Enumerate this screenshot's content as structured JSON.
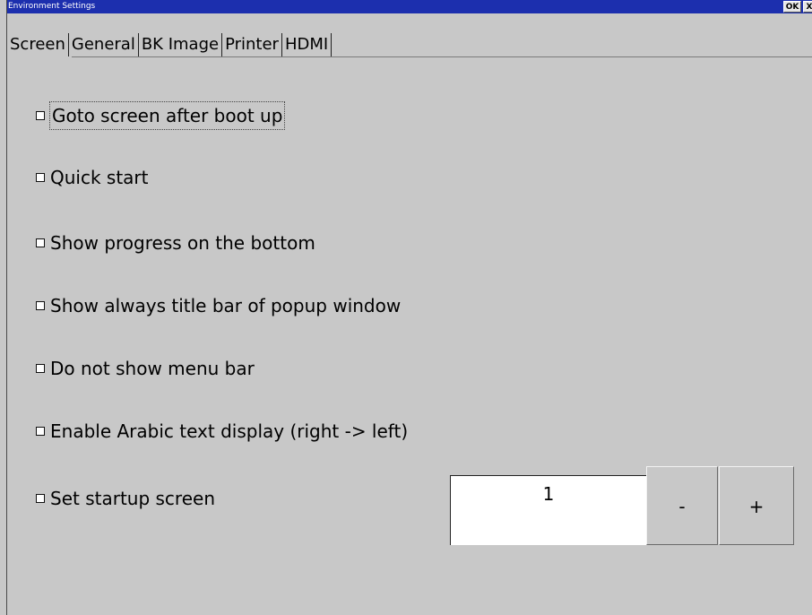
{
  "window": {
    "title": "Environment Settings",
    "ok_label": "OK",
    "close_label": "X"
  },
  "tabs": [
    {
      "label": "Screen",
      "active": true
    },
    {
      "label": "General",
      "active": false
    },
    {
      "label": "BK Image",
      "active": false
    },
    {
      "label": "Printer",
      "active": false
    },
    {
      "label": "HDMI",
      "active": false
    }
  ],
  "options": [
    {
      "label": "Goto screen after boot up",
      "checked": false
    },
    {
      "label": "Quick start",
      "checked": false
    },
    {
      "label": "Show progress on the bottom",
      "checked": false
    },
    {
      "label": "Show always title bar of popup window",
      "checked": false
    },
    {
      "label": "Do not show menu bar",
      "checked": false
    },
    {
      "label": "Enable Arabic text display (right -> left)",
      "checked": false
    },
    {
      "label": "Set startup screen",
      "checked": false
    }
  ],
  "startup_screen": {
    "value": "1",
    "decrement_label": "-",
    "increment_label": "+"
  },
  "colors": {
    "titlebar": "#1c2fae",
    "background": "#c8c8c8"
  }
}
